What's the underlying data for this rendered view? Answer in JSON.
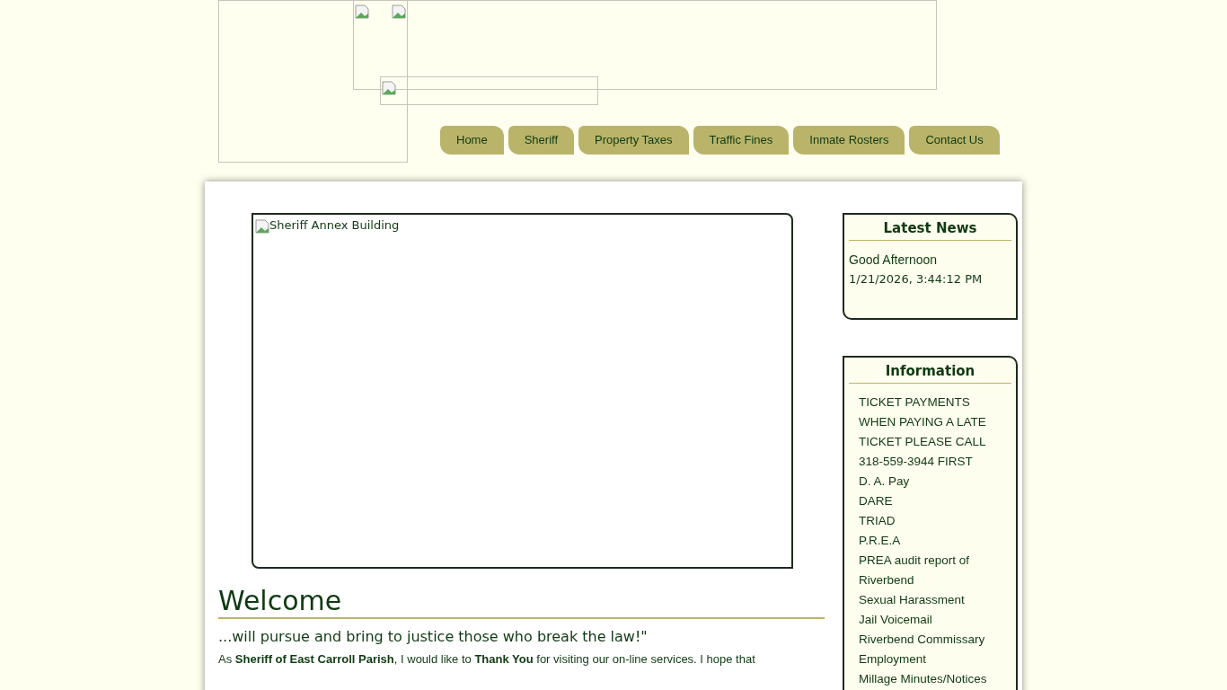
{
  "nav": [
    {
      "label": "Home"
    },
    {
      "label": "Sheriff"
    },
    {
      "label": "Property Taxes"
    },
    {
      "label": "Traffic Fines"
    },
    {
      "label": "Inmate Rosters"
    },
    {
      "label": "Contact Us"
    }
  ],
  "hero": {
    "alt": "Sheriff Annex Building"
  },
  "welcome": {
    "title": "Welcome",
    "tagline": "...will pursue and bring to justice those who break the law!\"",
    "body": "As **Sheriff of East Carroll Parish**, I would like to **Thank You** for visiting our on-line services. I hope that"
  },
  "latest_news": {
    "title": "Latest News",
    "greeting": "Good Afternoon",
    "datetime": "1/21/2026, 3:44:12 PM"
  },
  "information": {
    "title": "Information",
    "items": [
      "TICKET PAYMENTS",
      "WHEN PAYING A LATE TICKET PLEASE CALL 318-559-3944 FIRST",
      "D. A. Pay",
      "DARE",
      "TRIAD",
      "P.R.E.A",
      "PREA audit report of Riverbend",
      "Sexual Harassment",
      "Jail Voicemail",
      "Riverbend Commissary",
      "Employment",
      "Millage Minutes/Notices"
    ]
  }
}
